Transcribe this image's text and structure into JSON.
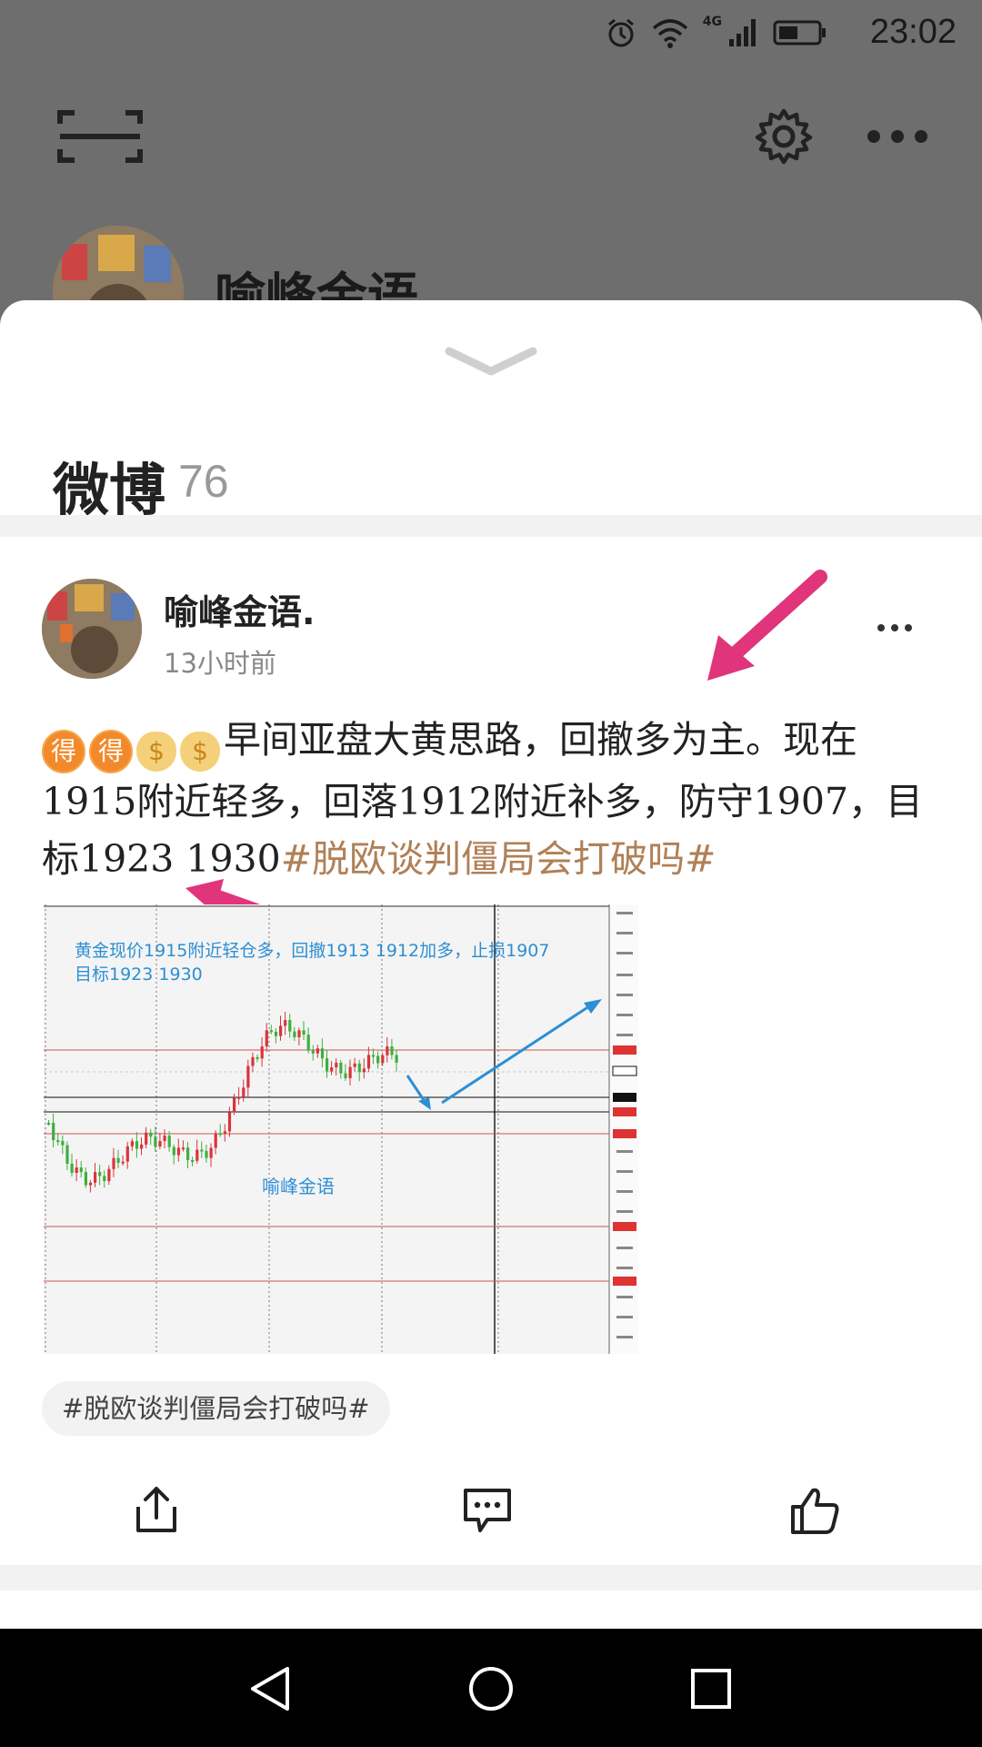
{
  "status_bar": {
    "time": "23:02",
    "network": "4G"
  },
  "profile_backdrop": {
    "name": "喻峰金语"
  },
  "sheet": {
    "title": "微博",
    "count": "76"
  },
  "post": {
    "author": "喻峰金语.",
    "time": "13小时前",
    "emojis": [
      "得",
      "得",
      "$",
      "$"
    ],
    "text": "早间亚盘大黄思路，回撤多为主。现在1915附近轻多，回落1912附近补多，防守1907，目标1923 1930",
    "hashtag": "#脱欧谈判僵局会打破吗#",
    "image": {
      "annotation_line1": "黄金现价1915附近轻仓多，回撤1913 1912加多，止损1907",
      "annotation_line2": "目标1923  1930",
      "watermark": "喻峰金语"
    },
    "topic_chip": "#脱欧谈判僵局会打破吗#"
  },
  "colors": {
    "hashtag": "#b08057",
    "arrow_pink": "#e0357a",
    "chart_blue": "#2d8fd4",
    "candle_up": "#d9343b",
    "candle_down": "#3db03d"
  },
  "icons": [
    "scan-icon",
    "gear-icon",
    "more-icon",
    "chevron-down-icon",
    "share-icon",
    "comment-icon",
    "like-icon",
    "back-icon",
    "home-icon",
    "recents-icon"
  ]
}
